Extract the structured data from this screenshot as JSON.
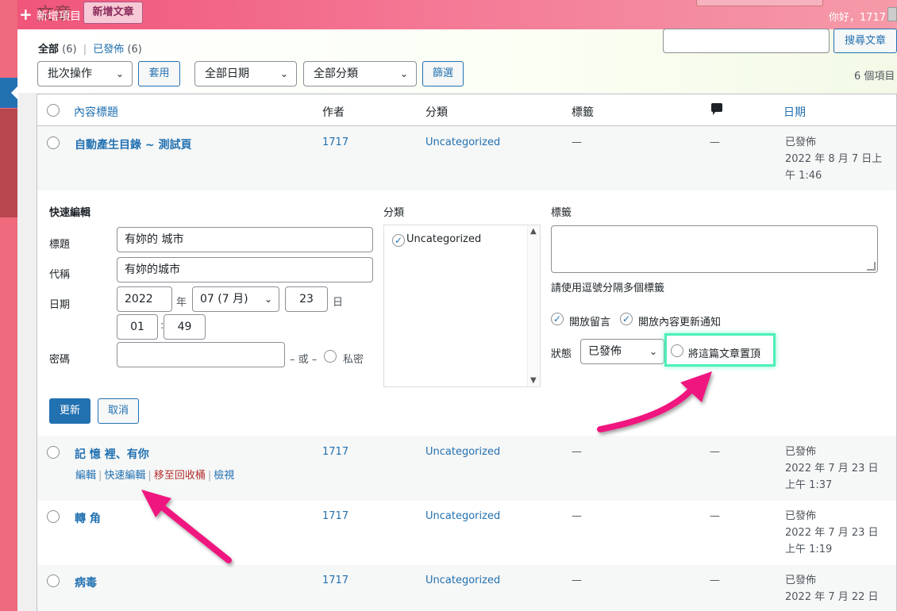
{
  "adminbar": {
    "new_item": "新增項目",
    "page_title": "文章",
    "add_new": "新增文章",
    "greeting": "你好，1717"
  },
  "filters": {
    "all_label": "全部",
    "all_count": "(6)",
    "published_label": "已發佈",
    "published_count": "(6)",
    "bulk_actions": "批次操作",
    "apply": "套用",
    "all_dates": "全部日期",
    "all_categories": "全部分類",
    "filter": "篩選",
    "search_button": "搜尋文章",
    "items_count": "6 個項目"
  },
  "table": {
    "columns": {
      "title": "內容標題",
      "author": "作者",
      "categories": "分類",
      "tags": "標籤",
      "date": "日期"
    },
    "rows": [
      {
        "title": "自動產生目錄 ~ 測試頁",
        "author": "1717",
        "category": "Uncategorized",
        "tags": "—",
        "comments": "—",
        "status": "已發佈",
        "date": "2022 年 8 月 7 日上午 1:46"
      },
      {
        "title": "記 憶 裡、有你",
        "author": "1717",
        "category": "Uncategorized",
        "tags": "—",
        "comments": "—",
        "status": "已發佈",
        "date": "2022 年 7 月 23 日上午 1:37"
      },
      {
        "title": "轉 角",
        "author": "1717",
        "category": "Uncategorized",
        "tags": "—",
        "comments": "—",
        "status": "已發佈",
        "date": "2022 年 7 月 23 日上午 1:19"
      },
      {
        "title": "病毒",
        "author": "1717",
        "category": "Uncategorized",
        "tags": "—",
        "comments": "—",
        "status": "已發佈",
        "date": "2022 年 7 月 22 日"
      }
    ],
    "row_actions": {
      "edit": "編輯",
      "quick_edit": "快速編輯",
      "trash": "移至回收桶",
      "view": "檢視"
    }
  },
  "quick_edit": {
    "heading": "快速編輯",
    "title_label": "標題",
    "title_value": "有妳的 城市",
    "slug_label": "代稱",
    "slug_value": "有妳的城市",
    "date_label": "日期",
    "year": "2022",
    "year_unit": "年",
    "month": "07 (7 月)",
    "day": "23",
    "day_unit": "日",
    "hour": "01",
    "minute": "49",
    "time_sep": ":",
    "password_label": "密碼",
    "or_text": "– 或 –",
    "private_label": "私密",
    "categories_label": "分類",
    "category_item": "Uncategorized",
    "tags_label": "標籤",
    "tags_hint": "請使用逗號分隔多個標籤",
    "allow_comments": "開放留言",
    "allow_pings": "開放內容更新通知",
    "status_label": "狀態",
    "status_value": "已發佈",
    "sticky_label": "將這篇文章置頂",
    "update_button": "更新",
    "cancel_button": "取消"
  },
  "colors": {
    "accent": "#2271b1",
    "highlight_box": "#4cf0b8",
    "annotation_arrow": "#f0177f"
  }
}
